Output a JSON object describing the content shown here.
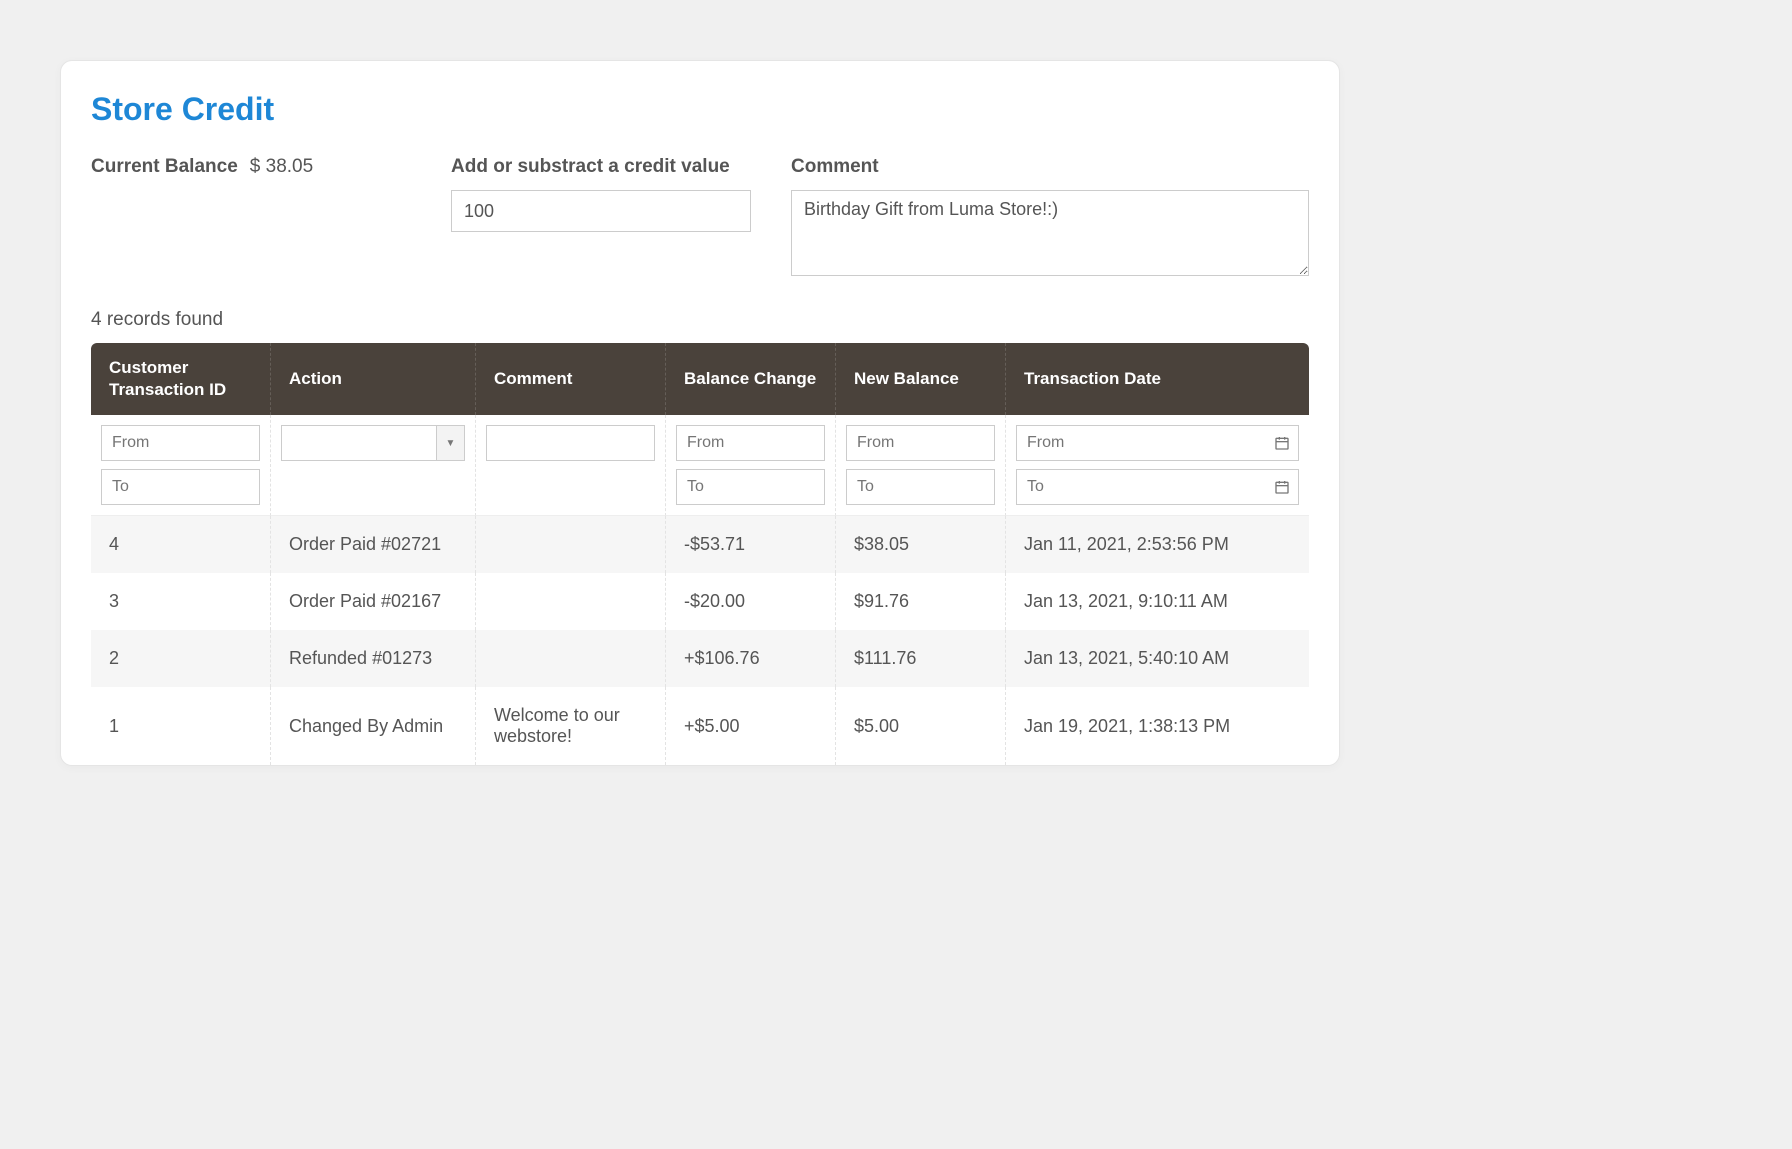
{
  "title": "Store Credit",
  "balance": {
    "label": "Current Balance",
    "value": "$ 38.05"
  },
  "credit_field": {
    "label": "Add or substract a credit value",
    "value": "100"
  },
  "comment_field": {
    "label": "Comment",
    "value": "Birthday Gift from Luma Store!:)"
  },
  "records_found": "4 records found",
  "columns": {
    "id": "Customer Transaction ID",
    "action": "Action",
    "comment": "Comment",
    "change": "Balance Change",
    "newbal": "New Balance",
    "date": "Transaction Date"
  },
  "filters": {
    "from": "From",
    "to": "To"
  },
  "rows": [
    {
      "id": "4",
      "action": "Order Paid #02721",
      "comment": "",
      "change": "-$53.71",
      "change_sign": "neg",
      "newbal": "$38.05",
      "date": "Jan 11, 2021, 2:53:56 PM"
    },
    {
      "id": "3",
      "action": "Order Paid #02167",
      "comment": "",
      "change": "-$20.00",
      "change_sign": "neg",
      "newbal": "$91.76",
      "date": "Jan 13, 2021, 9:10:11 AM"
    },
    {
      "id": "2",
      "action": "Refunded #01273",
      "comment": "",
      "change": "+$106.76",
      "change_sign": "pos",
      "newbal": "$111.76",
      "date": "Jan 13, 2021, 5:40:10 AM"
    },
    {
      "id": "1",
      "action": "Changed By Admin",
      "comment": "Welcome to our webstore!",
      "change": "+$5.00",
      "change_sign": "pos",
      "newbal": "$5.00",
      "date": "Jan 19, 2021, 1:38:13 PM"
    }
  ]
}
